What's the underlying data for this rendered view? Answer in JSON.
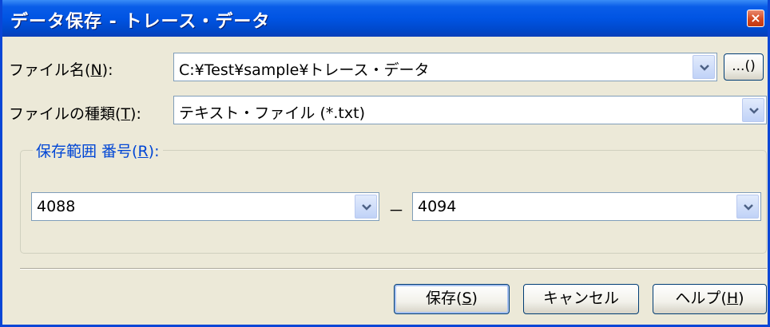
{
  "window": {
    "title": "データ保存 - トレース・データ",
    "close_glyph": "×"
  },
  "filename": {
    "label": "ファイル名",
    "mnemonic": "N",
    "value": "C:¥Test¥sample¥トレース・データ"
  },
  "browse_button": {
    "label": "...()"
  },
  "filetype": {
    "label": "ファイルの種類",
    "mnemonic": "T",
    "value": "テキスト・ファイル (*.txt)"
  },
  "range": {
    "group_label": "保存範囲 番号",
    "mnemonic": "R",
    "from": "4088",
    "separator": "－",
    "to": "4094"
  },
  "buttons": {
    "save": {
      "label": "保存",
      "mnemonic": "S"
    },
    "cancel": {
      "label": "キャンセル"
    },
    "help": {
      "label": "ヘルプ",
      "mnemonic": "H"
    }
  }
}
